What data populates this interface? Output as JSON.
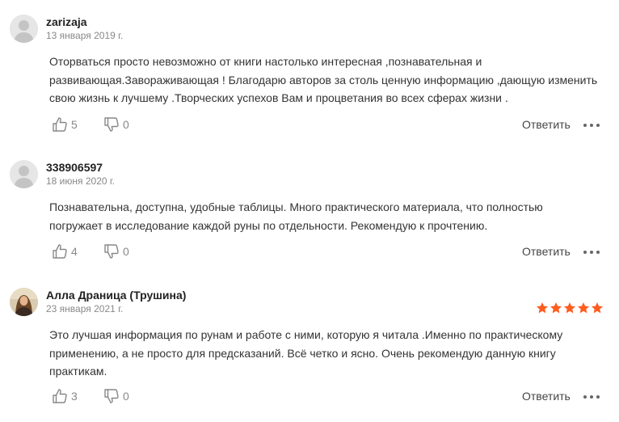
{
  "colors": {
    "star": "#ff5c1f",
    "avatar_bg": "#e6e6e6",
    "icon": "#888888"
  },
  "reviews": [
    {
      "author": "zarizaja",
      "date": "13 января 2019 г.",
      "text": "Оторваться просто невозможно от книги настолько интересная ,познавательная и развивающая.Завораживающая ! Благодарю авторов за столь ценную информацию ,дающую изменить свою жизнь к лучшему .Творческих успехов Вам и процветания во всех сферах жизни .",
      "likes": "5",
      "dislikes": "0",
      "reply_label": "Ответить",
      "avatar": "default-avatar-icon"
    },
    {
      "author": "338906597",
      "date": "18 июня 2020 г.",
      "text": "Познавательна, доступна, удобные таблицы. Много практического материала, что полностью погружает в исследование каждой руны по отдельности. Рекомендую к прочтению.",
      "likes": "4",
      "dislikes": "0",
      "reply_label": "Ответить",
      "avatar": "default-avatar-icon"
    },
    {
      "author": "Алла Драница (Трушина)",
      "date": "23 января 2021 г.",
      "rating": 5,
      "rating_max": 5,
      "text": "Это лучшая информация по рунам и работе с ними, которую я читала .Именно по практическому применению, а не просто для предсказаний. Всё четко и ясно. Очень рекомендую данную книгу практикам.",
      "likes": "3",
      "dislikes": "0",
      "reply_label": "Ответить",
      "avatar": "photo-avatar"
    }
  ]
}
